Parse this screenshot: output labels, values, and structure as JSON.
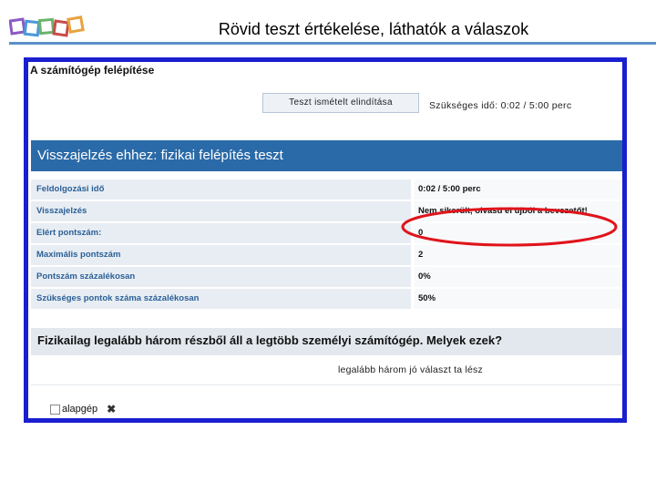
{
  "slide": {
    "title": "Rövid teszt értékelése, láthatók a válaszok",
    "logo_colors": [
      "#8a5bc4",
      "#4a9ad8",
      "#e8a33d",
      "#c94b4b",
      "#6bb36b"
    ]
  },
  "screen": {
    "section_title": "A számítógép felépítése",
    "restart_label": "Teszt ismételt elindítása",
    "time_text": "Szükséges idő: 0:02 / 5:00 perc",
    "feedback_title": "Visszajelzés ehhez: fizikai felépítés teszt",
    "rows": [
      {
        "label": "Feldolgozási idő",
        "value": "0:02 / 5:00 perc"
      },
      {
        "label": "Visszajelzés",
        "value": "Nem sikerült, olvasd el újból a bevezetőt!"
      },
      {
        "label": "Elért pontszám:",
        "value": "0"
      },
      {
        "label": "Maximális pontszám",
        "value": "2"
      },
      {
        "label": "Pontszám százalékosan",
        "value": "0%"
      },
      {
        "label": "Szükséges pontok száma százalékosan",
        "value": "50%"
      }
    ],
    "question": "Fizikailag legalább három részből áll a legtöbb személyi számítógép. Melyek ezek?",
    "hint": "legalább három jó választ ta lész",
    "answers": [
      {
        "label": "alapgép",
        "icon": "x-mark-icon"
      }
    ]
  },
  "annotation": {
    "color": "#e0141b"
  }
}
